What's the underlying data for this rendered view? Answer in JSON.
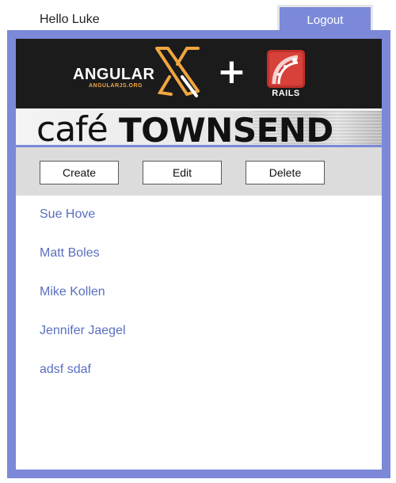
{
  "header": {
    "greeting": "Hello Luke",
    "logout_label": "Logout"
  },
  "banner": {
    "angular_text": "ANGULAR",
    "angular_sub": "ANGULARJS.ORG",
    "plus": "+",
    "rails_text": "RAILS",
    "cafe_script": "café",
    "cafe_bold": "TOWNSEND"
  },
  "toolbar": {
    "create_label": "Create",
    "edit_label": "Edit",
    "delete_label": "Delete"
  },
  "employees": [
    "Sue Hove",
    "Matt Boles",
    "Mike Kollen",
    "Jennifer Jaegel",
    "adsf sdaf"
  ],
  "colors": {
    "accent": "#7b89d8",
    "link": "#5a6fc0",
    "toolbar_bg": "#dcdcdc",
    "banner_bg": "#1b1b1b"
  }
}
